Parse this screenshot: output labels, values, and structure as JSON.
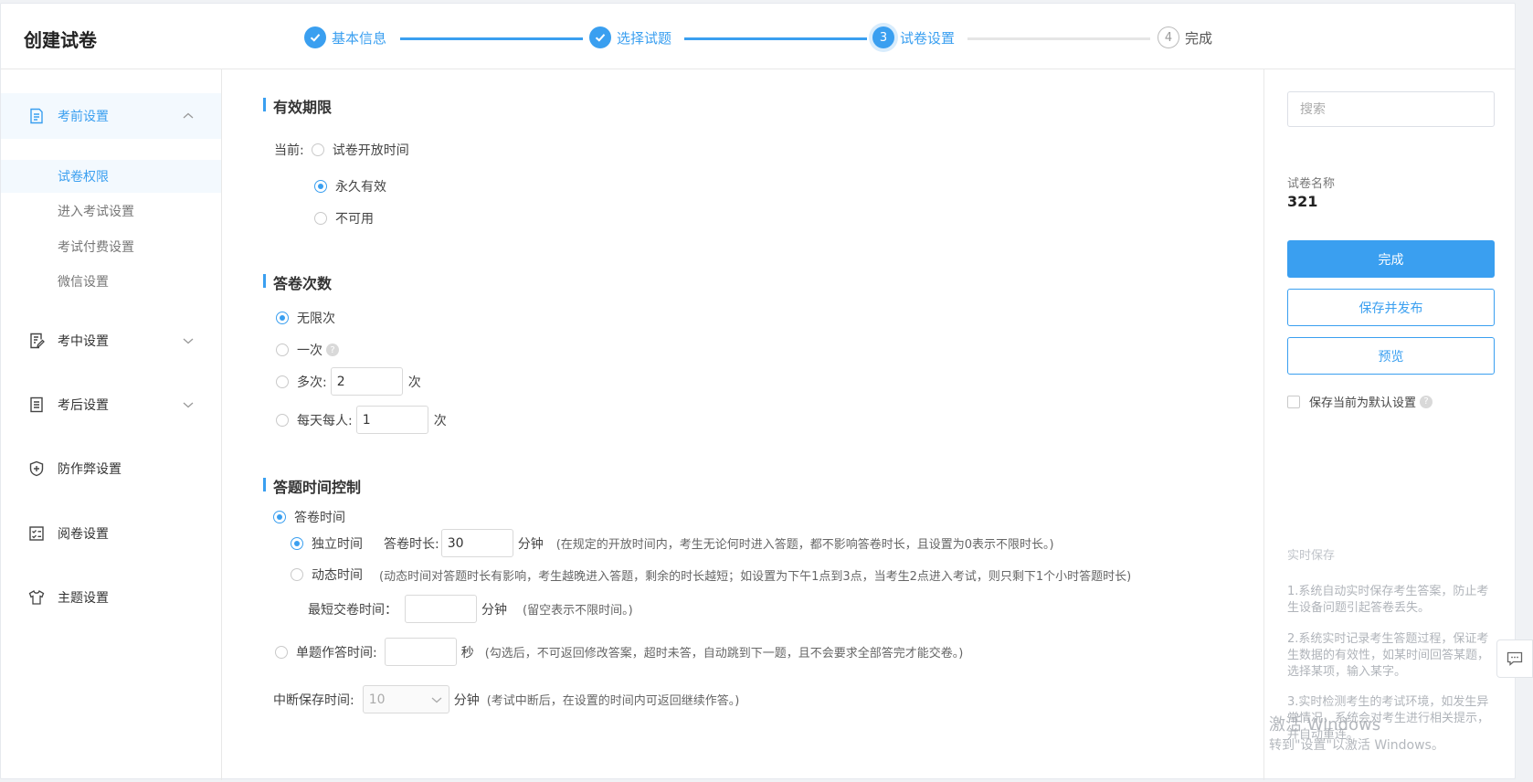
{
  "header": {
    "title": "创建试卷",
    "steps": [
      {
        "label": "基本信息",
        "state": "done"
      },
      {
        "label": "选择试题",
        "state": "done"
      },
      {
        "number": "3",
        "label": "试卷设置",
        "state": "active"
      },
      {
        "number": "4",
        "label": "完成",
        "state": "todo"
      }
    ]
  },
  "sidebar": {
    "groups": [
      {
        "label": "考前设置",
        "icon": "document-icon",
        "expanded": true
      },
      {
        "label": "考中设置",
        "icon": "edit-form-icon",
        "expanded": false
      },
      {
        "label": "考后设置",
        "icon": "list-form-icon",
        "expanded": false
      },
      {
        "label": "防作弊设置",
        "icon": "shield-plus-icon"
      },
      {
        "label": "阅卷设置",
        "icon": "checklist-icon"
      },
      {
        "label": "主题设置",
        "icon": "tshirt-icon"
      }
    ],
    "subitems": [
      {
        "label": "试卷权限",
        "active": true
      },
      {
        "label": "进入考试设置"
      },
      {
        "label": "考试付费设置"
      },
      {
        "label": "微信设置"
      }
    ]
  },
  "validity": {
    "title": "有效期限",
    "current_label": "当前:",
    "options": [
      "试卷开放时间",
      "永久有效",
      "不可用"
    ],
    "selected": "永久有效"
  },
  "attempts": {
    "title": "答卷次数",
    "unlimited": "无限次",
    "once": "一次",
    "multiple_label": "多次:",
    "multiple_value": "2",
    "multiple_unit": "次",
    "daily_label": "每天每人:",
    "daily_value": "1",
    "daily_unit": "次",
    "selected": "无限次"
  },
  "time_control": {
    "title": "答题时间控制",
    "answer_time": "答卷时间",
    "independent": "独立时间",
    "duration_label": "答卷时长:",
    "duration_value": "30",
    "minutes": "分钟",
    "independent_hint": "(在规定的开放时间内，考生无论何时进入答题，都不影响答卷时长，且设置为0表示不限时长。)",
    "dynamic": "动态时间",
    "dynamic_hint": "(动态时间对答题时长有影响，考生越晚进入答题，剩余的时长越短；如设置为下午1点到3点，当考生2点进入考试，则只剩下1个小时答题时长)",
    "min_submit_label": "最短交卷时间：",
    "min_submit_hint": "(留空表示不限时间。)",
    "single_label": "单题作答时间:",
    "seconds": "秒",
    "single_hint": "(勾选后，不可返回修改答案，超时未答，自动跳到下一题，且不会要求全部答完才能交卷。)",
    "interrupt_label": "中断保存时间:",
    "interrupt_value": "10",
    "interrupt_hint": "(考试中断后，在设置的时间内可返回继续作答。)"
  },
  "right_panel": {
    "search_placeholder": "搜索",
    "paper_name_label": "试卷名称",
    "paper_name": "321",
    "finish": "完成",
    "save_publish": "保存并发布",
    "preview": "预览",
    "default_label": "保存当前为默认设置",
    "tips_title": "实时保存",
    "tips": [
      "1.系统自动实时保存考生答案，防止考生设备问题引起答卷丢失。",
      "2.系统实时记录考生答题过程，保证考生数据的有效性，如某时间回答某题，选择某项，输入某字。",
      "3.实时检测考生的考试环境，如发生异常情况，系统会对考生进行相关提示，并自动重连。"
    ]
  },
  "watermark": {
    "line1": "激活 Windows",
    "line2": "转到\"设置\"以激活 Windows。"
  },
  "colors": {
    "accent": "#3a9ff0"
  }
}
